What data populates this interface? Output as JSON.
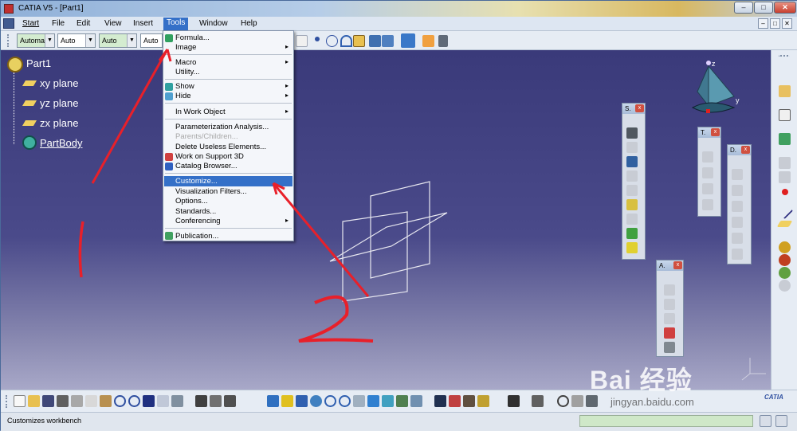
{
  "window": {
    "title": "CATIA V5 - [Part1]",
    "min": "–",
    "max": "□",
    "close": "✕",
    "doc_min": "–",
    "doc_max": "□",
    "doc_close": "✕"
  },
  "menubar": {
    "items": [
      "Start",
      "File",
      "Edit",
      "View",
      "Insert",
      "Tools",
      "Window",
      "Help"
    ],
    "active": "Tools"
  },
  "toolbar": {
    "combos": [
      "Automa",
      "Auto",
      "Auto",
      "Auto"
    ]
  },
  "tree": {
    "root": "Part1",
    "nodes": [
      "xy plane",
      "yz plane",
      "zx plane",
      "PartBody"
    ]
  },
  "tools_menu": {
    "items": {
      "formula": "Formula...",
      "image": "Image",
      "macro": "Macro",
      "utility": "Utility...",
      "show": "Show",
      "hide": "Hide",
      "in_work_object": "In Work Object",
      "param_analysis": "Parameterization Analysis...",
      "parents_children": "Parents/Children...",
      "delete_useless": "Delete Useless Elements...",
      "work_on_support": "Work on Support 3D",
      "catalog_browser": "Catalog Browser...",
      "customize": "Customize...",
      "vis_filters": "Visualization Filters...",
      "options": "Options...",
      "standards": "Standards...",
      "conferencing": "Conferencing",
      "publication": "Publication..."
    },
    "highlighted": "Customize...",
    "submenu_arrow": "▸"
  },
  "palettes": {
    "s": "S.",
    "t": "T.",
    "d": "D.",
    "a": "A.",
    "close": "x"
  },
  "compass": {
    "z": "z",
    "y": "y"
  },
  "annotations": {
    "first": "1",
    "second": "2"
  },
  "status": {
    "text": "Customizes workbench"
  },
  "watermark": {
    "brand": "Bai  经验",
    "url": "jingyan.baidu.com",
    "catia": "CATIA"
  },
  "colors": {
    "viewport_top": "#3a3a7a",
    "menu_highlight": "#3470c8",
    "annotation": "#e8202a"
  }
}
